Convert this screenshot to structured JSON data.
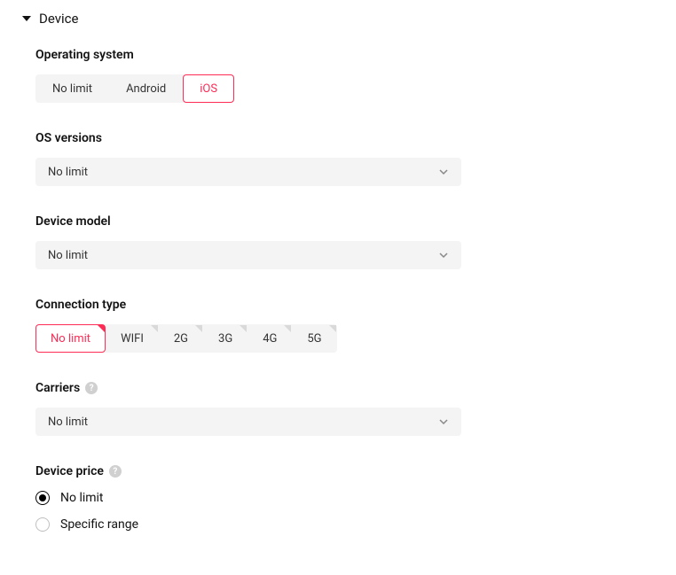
{
  "section": {
    "title": "Device"
  },
  "os": {
    "label": "Operating system",
    "options": [
      "No limit",
      "Android",
      "iOS"
    ],
    "selected": "iOS"
  },
  "os_versions": {
    "label": "OS versions",
    "value": "No limit"
  },
  "device_model": {
    "label": "Device model",
    "value": "No limit"
  },
  "connection": {
    "label": "Connection type",
    "options": [
      "No limit",
      "WIFI",
      "2G",
      "3G",
      "4G",
      "5G"
    ],
    "selected": "No limit"
  },
  "carriers": {
    "label": "Carriers",
    "value": "No limit"
  },
  "device_price": {
    "label": "Device price",
    "options": [
      "No limit",
      "Specific range"
    ],
    "selected": "No limit"
  }
}
